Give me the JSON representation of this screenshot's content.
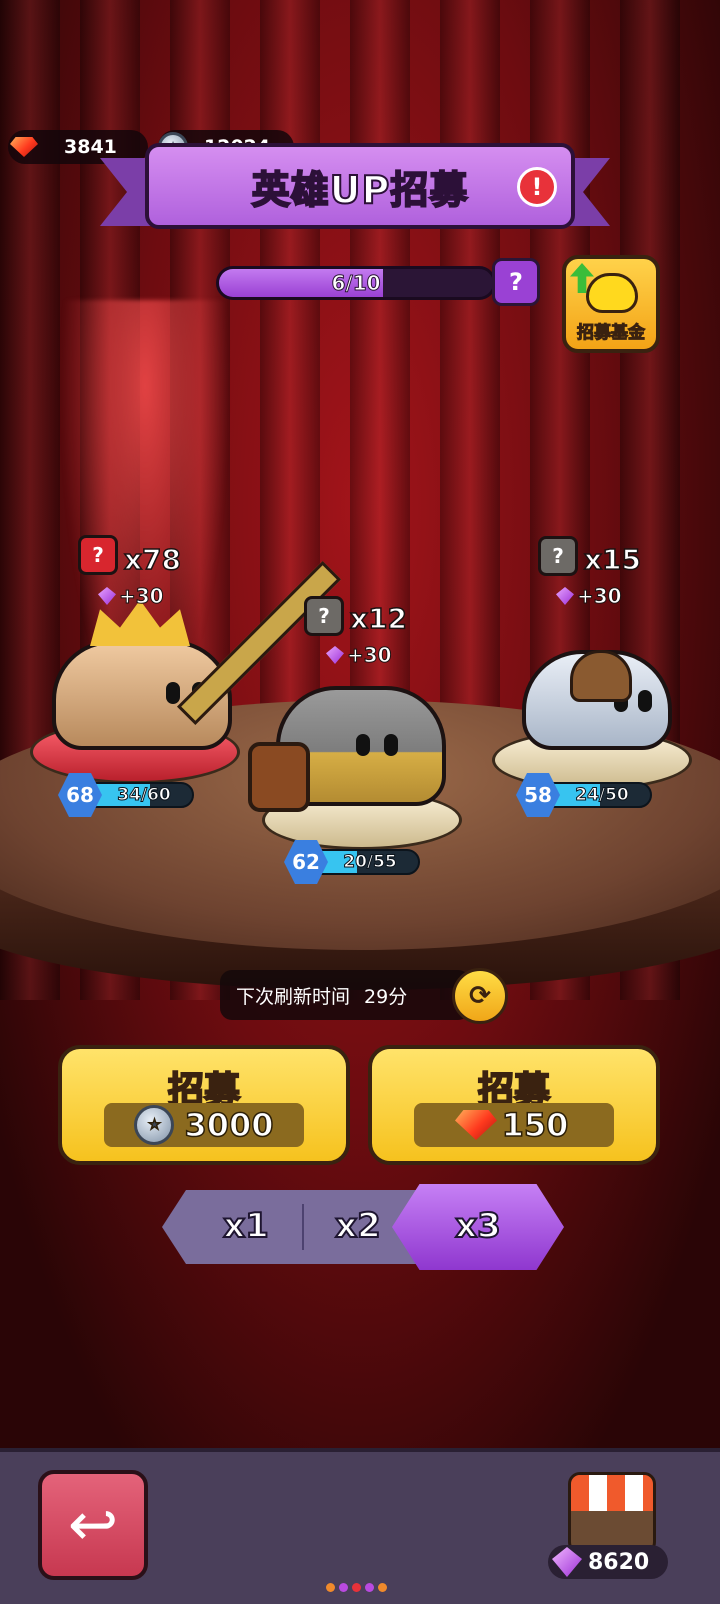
{
  "currencies": {
    "gems": "3841",
    "coins": "12024"
  },
  "banner": {
    "title": "英雄UP招募",
    "alert_symbol": "!"
  },
  "pity_progress": {
    "text": "6/10",
    "current": 6,
    "max": 10,
    "help_symbol": "?"
  },
  "fund_button": {
    "label": "招募基金"
  },
  "heroes": [
    {
      "count": "x78",
      "bonus": "+30",
      "level": "68",
      "progress_text": "34/60",
      "progress_fraction": 0.567,
      "rarity_symbol": "?",
      "rarity_color": "#d8262e"
    },
    {
      "count": "x12",
      "bonus": "+30",
      "level": "62",
      "progress_text": "20/55",
      "progress_fraction": 0.364,
      "rarity_symbol": "?",
      "rarity_color": "#6d6a66"
    },
    {
      "count": "x15",
      "bonus": "+30",
      "level": "58",
      "progress_text": "24/50",
      "progress_fraction": 0.48,
      "rarity_symbol": "?",
      "rarity_color": "#6d6a66"
    }
  ],
  "refresh": {
    "label": "下次刷新时间",
    "time": "29分"
  },
  "recruit_buttons": [
    {
      "label": "招募",
      "cost": "3000",
      "currency": "coin"
    },
    {
      "label": "招募",
      "cost": "150",
      "currency": "gem"
    }
  ],
  "multipliers": {
    "options": [
      "x1",
      "x2",
      "x3"
    ],
    "selected": "x3"
  },
  "bottom_bar": {
    "shop_gems": "8620"
  },
  "colors": {
    "accent_purple": "#b061dd",
    "button_yellow": "#f6c21e",
    "back_button": "#c73850"
  }
}
